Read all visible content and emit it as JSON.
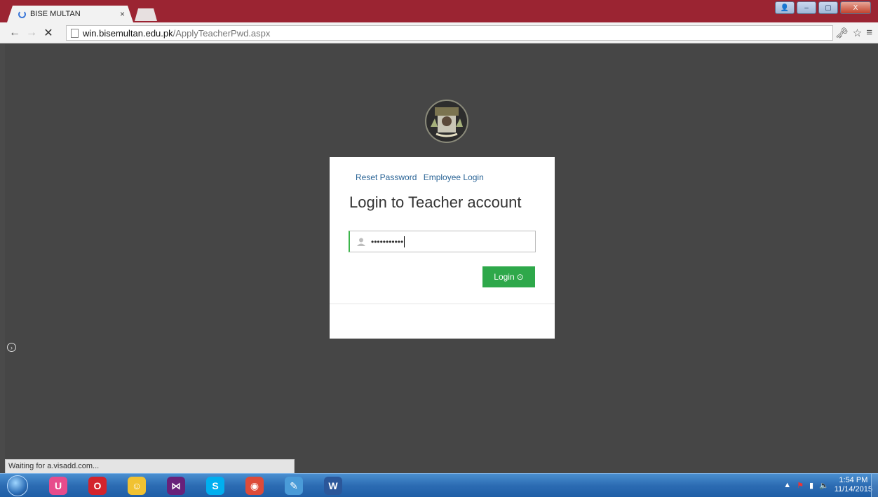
{
  "browser": {
    "tab_title": "BISE MULTAN",
    "tab_close": "×",
    "url_host": "win.bisemultan.edu.pk",
    "url_path": "/ApplyTeacherPwd.aspx",
    "window_controls": {
      "profile": "👤",
      "minimize": "–",
      "maximize": "▢",
      "close": "X"
    },
    "icons": {
      "back": "←",
      "forward": "→",
      "stop": "✕",
      "key": "🗝",
      "star": "☆",
      "menu": "≡"
    },
    "status_text": "Waiting for a.visadd.com..."
  },
  "card": {
    "reset_link": "Reset Password",
    "employee_link": "Employee Login",
    "title": "Login to Teacher account",
    "password_value": "•••••••••••",
    "login_label": "Login",
    "login_arrow": "⊙"
  },
  "page": {
    "side_arrow": "›"
  },
  "taskbar": {
    "apps": [
      {
        "name": "uc-browser",
        "glyph": "U",
        "color": "#e74c8c"
      },
      {
        "name": "opera",
        "glyph": "O",
        "color": "#d3232c"
      },
      {
        "name": "yellow-app",
        "glyph": "☺",
        "color": "#f1c232"
      },
      {
        "name": "visual-studio",
        "glyph": "⋈",
        "color": "#68217a"
      },
      {
        "name": "skype",
        "glyph": "S",
        "color": "#00aff0"
      },
      {
        "name": "chrome",
        "glyph": "◉",
        "color": "#dd4b39"
      },
      {
        "name": "paint",
        "glyph": "✎",
        "color": "#4a9bd8"
      },
      {
        "name": "word",
        "glyph": "W",
        "color": "#2b579a"
      }
    ],
    "time": "1:54 PM",
    "date": "11/14/2015",
    "tray_expand": "▲"
  }
}
